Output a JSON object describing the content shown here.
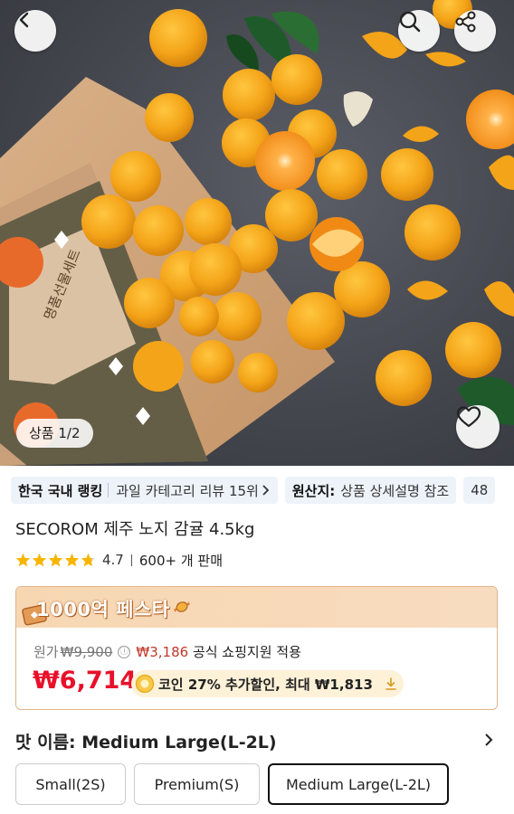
{
  "hero": {
    "counter": "상품 1/2",
    "box_text": "명품선물세트",
    "icons": {
      "back": "chevron-left-icon",
      "search": "search-icon",
      "share": "share-icon",
      "like": "heart-icon"
    }
  },
  "chips": [
    {
      "bold": "한국 국내 랭킹",
      "text": "과일 카테고리 리뷰 15위"
    },
    {
      "bold": "원산지:",
      "text": "상품 상세설명 참조"
    },
    {
      "text": "48"
    }
  ],
  "product": {
    "title": "SECOROM 제주 노지 감귤 4.5kg",
    "rating": 4.7,
    "rating_text": "4.7",
    "stars": 5,
    "sales": "600+ 개 판매"
  },
  "price": {
    "festival": "1000억 페스타",
    "original_label": "원가",
    "original_price": "₩9,900",
    "info_icon": "ⓘ",
    "support_amount": "₩3,186",
    "support_text": " 공식 쇼핑지원 적용",
    "sale_price": "₩6,714",
    "coin_text": "코인 27% 추가할인, 최대 ₩1,813"
  },
  "options": {
    "label": "맛 이름: Medium Large(L-2L)",
    "items": [
      "Small(2S)",
      "Premium(S)",
      "Medium Large(L-2L)"
    ],
    "selected": 2
  },
  "colors": {
    "sale_red": "#e8102a",
    "festival_bg": "#f7d7b2",
    "chip_bg": "#eef3fa"
  }
}
